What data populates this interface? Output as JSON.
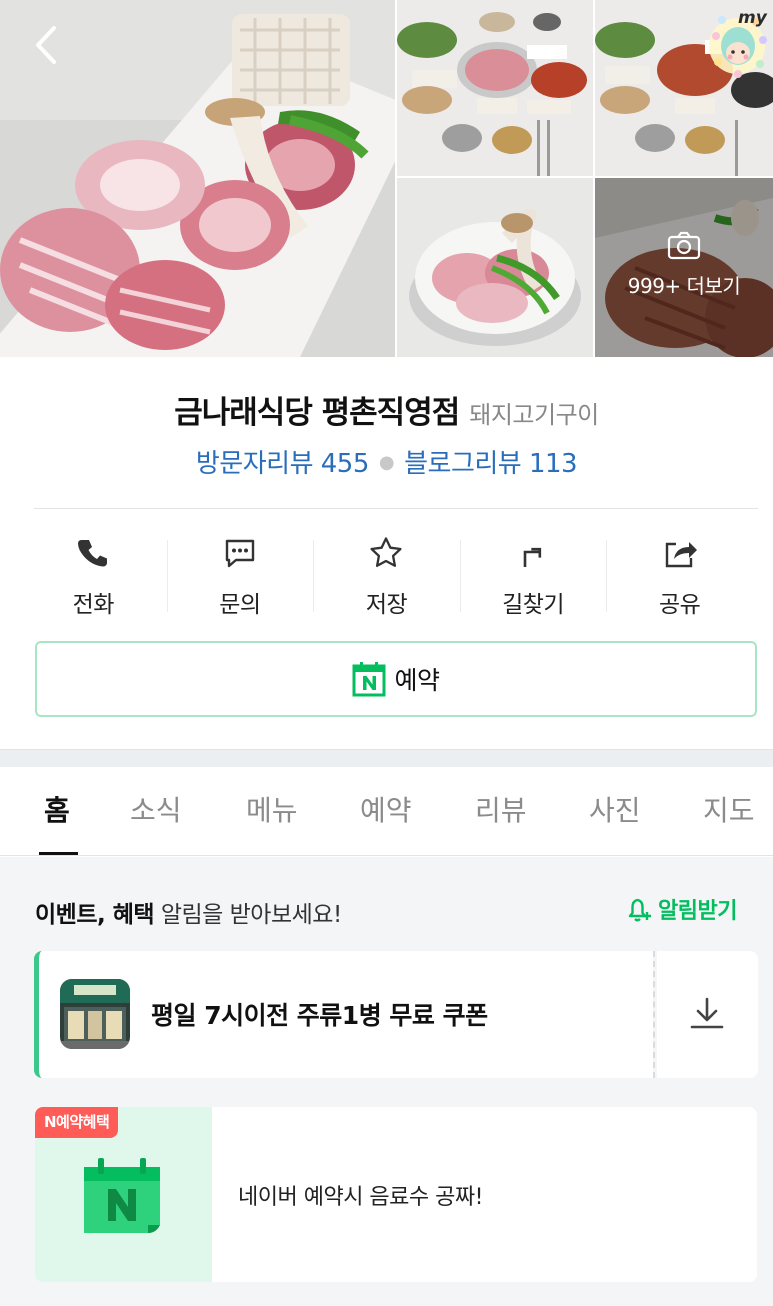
{
  "gallery": {
    "more_label": "999+ 더보기",
    "my_badge": "my"
  },
  "place": {
    "name": "금나래식당 평촌직영점",
    "category": "돼지고기구이",
    "visitor_reviews": "방문자리뷰 455",
    "blog_reviews": "블로그리뷰 113"
  },
  "actions": [
    {
      "label": "전화",
      "icon": "phone-icon"
    },
    {
      "label": "문의",
      "icon": "chat-icon"
    },
    {
      "label": "저장",
      "icon": "star-icon"
    },
    {
      "label": "길찾기",
      "icon": "directions-icon"
    },
    {
      "label": "공유",
      "icon": "share-icon"
    }
  ],
  "reserve": {
    "label": "예약",
    "icon": "naver-calendar-icon"
  },
  "tabs": [
    {
      "label": "홈",
      "active": true
    },
    {
      "label": "소식",
      "active": false
    },
    {
      "label": "메뉴",
      "active": false
    },
    {
      "label": "예약",
      "active": false
    },
    {
      "label": "리뷰",
      "active": false
    },
    {
      "label": "사진",
      "active": false
    },
    {
      "label": "지도",
      "active": false
    }
  ],
  "notice": {
    "bold": "이벤트, 혜택",
    "text": " 알림을 받아보세요!",
    "button": "알림받기"
  },
  "coupon": {
    "title": "평일 7시이전 주류1병 무료 쿠폰",
    "download_icon": "download-icon"
  },
  "promo": {
    "badge": "N예약혜택",
    "text": "네이버 예약시 음료수 공짜!"
  },
  "colors": {
    "naver_green": "#03bd5e",
    "link_blue": "#2a6ebb",
    "badge_red": "#ff5b57"
  }
}
